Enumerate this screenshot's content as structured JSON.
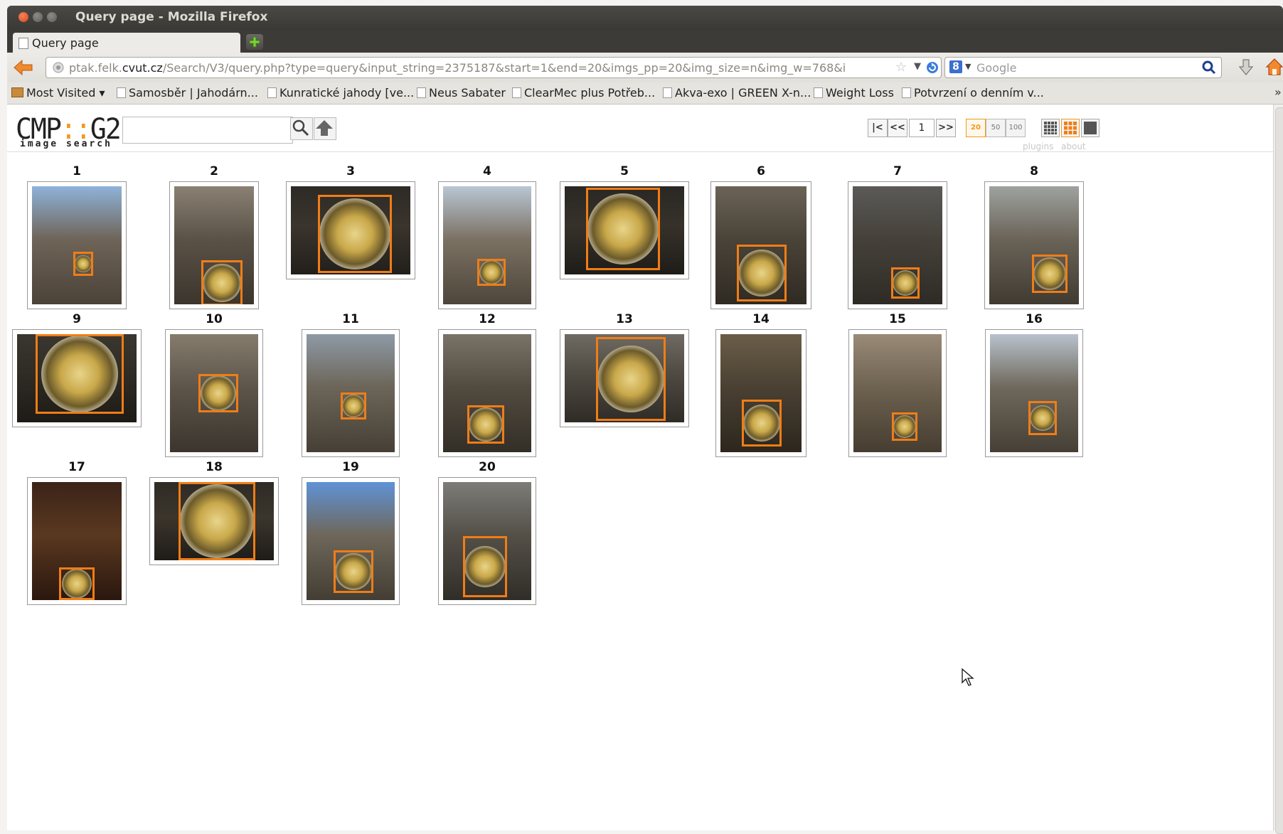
{
  "window": {
    "title": "Query page - Mozilla Firefox"
  },
  "tab": {
    "label": "Query page"
  },
  "address": {
    "url_prefix": "ptak.felk.",
    "url_domain": "cvut.cz",
    "url_rest": "/Search/V3/query.php?type=query&input_string=2375187&start=1&end=20&imgs_pp=20&img_size=n&img_w=768&i"
  },
  "search": {
    "placeholder": "Google"
  },
  "bookmarks": [
    "Most Visited",
    "Samosběr | Jahodárn...",
    "Kunratické jahody [ve...",
    "Neus Sabater",
    "ClearMec plus Potřeb...",
    "Akva-exo | GREEN X-n...",
    "Weight Loss",
    "Potvrzení o denním v..."
  ],
  "app": {
    "logo_main_a": "CMP",
    "logo_main_dots": "::",
    "logo_main_b": "G2",
    "logo_sub": "image search",
    "query_value": "",
    "page_number": "1",
    "per_page_options": [
      "20",
      "50",
      "100"
    ],
    "per_page_selected": "20",
    "links": {
      "plugins": "plugins",
      "about": "about"
    }
  },
  "results": [
    {
      "n": "1"
    },
    {
      "n": "2"
    },
    {
      "n": "3"
    },
    {
      "n": "4"
    },
    {
      "n": "5"
    },
    {
      "n": "6"
    },
    {
      "n": "7"
    },
    {
      "n": "8"
    },
    {
      "n": "9"
    },
    {
      "n": "10"
    },
    {
      "n": "11"
    },
    {
      "n": "12"
    },
    {
      "n": "13"
    },
    {
      "n": "14"
    },
    {
      "n": "15"
    },
    {
      "n": "16"
    },
    {
      "n": "17"
    },
    {
      "n": "18"
    },
    {
      "n": "19"
    },
    {
      "n": "20"
    }
  ],
  "colors": {
    "accent": "#f09a1e",
    "detection_box": "#f07d16",
    "tab_bg": "#3c3b37"
  }
}
